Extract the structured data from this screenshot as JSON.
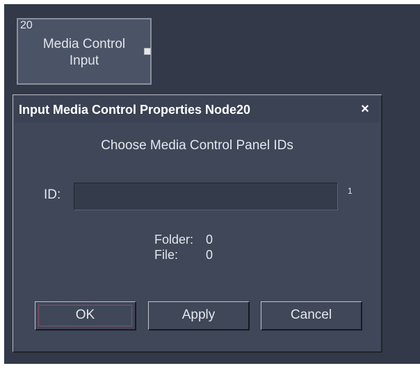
{
  "node": {
    "id": "20",
    "title_line1": "Media Control",
    "title_line2": "Input"
  },
  "dialog": {
    "title": "Input Media Control Properties Node20",
    "close_symbol": "×",
    "heading": "Choose Media Control Panel IDs",
    "id_label": "ID:",
    "id_value": "",
    "id_count": "1",
    "folder_label": "Folder:",
    "folder_value": "0",
    "file_label": "File:",
    "file_value": "0",
    "buttons": {
      "ok": "OK",
      "apply": "Apply",
      "cancel": "Cancel"
    }
  },
  "colors": {
    "background": "#333948",
    "dialog": "#3f4759",
    "text": "#e4e7eb",
    "focus_outline": "#d85d6c"
  }
}
